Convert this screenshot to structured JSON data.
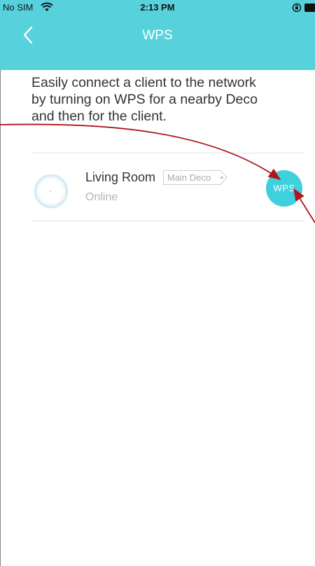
{
  "status_bar": {
    "carrier": "No SIM",
    "time": "2:13 PM",
    "icons": [
      "wifi-icon",
      "lock-rotation-icon",
      "battery-icon"
    ]
  },
  "nav": {
    "title": "WPS",
    "back_icon": "chevron-left-icon"
  },
  "instructions": {
    "line1": "Easily connect a client to the network",
    "line2": "by turning on WPS for a nearby Deco",
    "line3": "and then for the client."
  },
  "device": {
    "name": "Living Room",
    "tag": "Main Deco",
    "status": "Online",
    "icon": "deco-device-icon",
    "wps_label": "WPS"
  },
  "colors": {
    "header": "#57d2dd",
    "wps_button": "#3fd0dd",
    "annotation_arrow": "#b0161c"
  }
}
